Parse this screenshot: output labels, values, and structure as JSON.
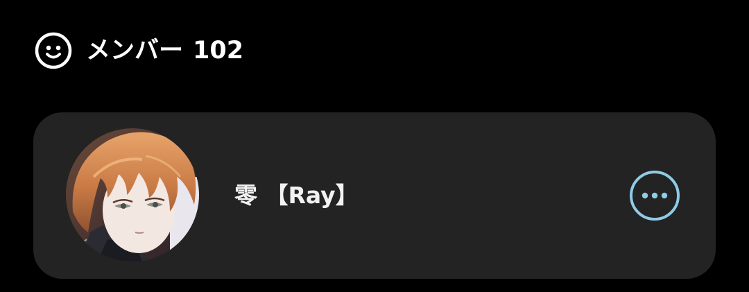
{
  "members_section": {
    "icon": "smiley-face-icon",
    "title": "メンバー",
    "count": "102"
  },
  "member": {
    "name": "零 【Ray】",
    "avatar": "anime-portrait-avatar",
    "more_icon": "more-options-icon"
  },
  "colors": {
    "background": "#000000",
    "card": "#232323",
    "text": "#ffffff",
    "accent": "#8ecbe7"
  }
}
